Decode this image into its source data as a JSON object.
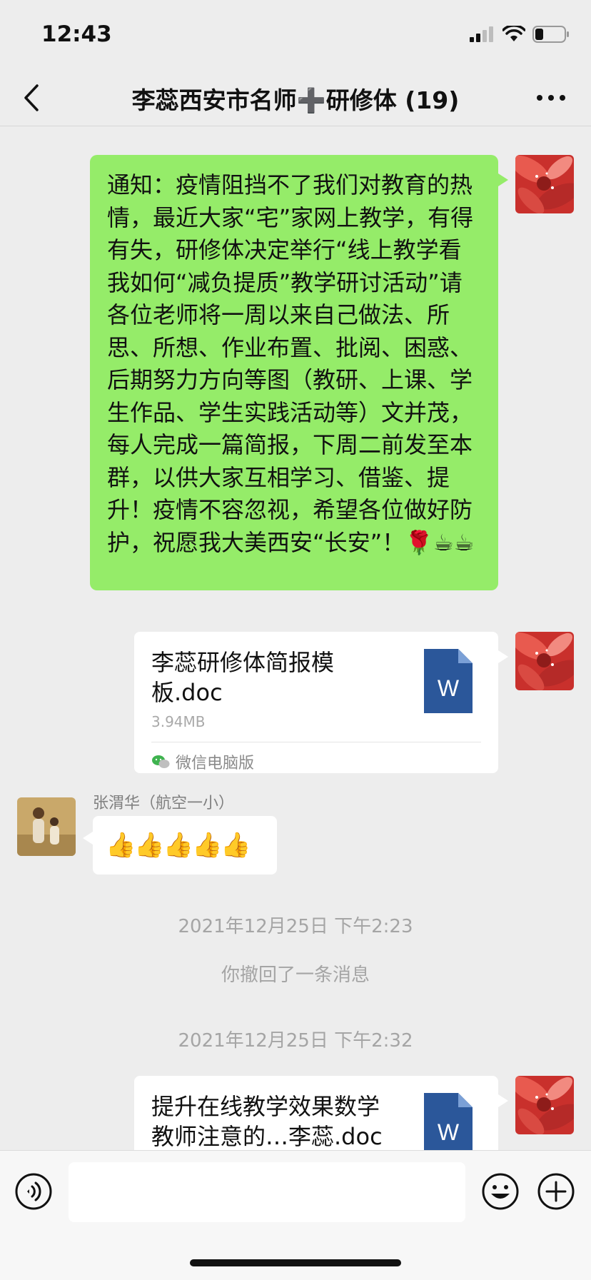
{
  "status_bar": {
    "time": "12:43"
  },
  "header": {
    "title": "李蕊西安市名师➕研修体 (19)"
  },
  "messages": {
    "notice": {
      "text": "通知：疫情阻挡不了我们对教育的热情，最近大家“宅”家网上教学，有得有失，研修体决定举行“线上教学看我如何“减负提质”教学研讨活动”请各位老师将一周以来自己做法、所思、所想、作业布置、批阅、困惑、后期努力方向等图（教研、上课、学生作品、学生实践活动等）文并茂，每人完成一篇简报，下周二前发至本群，以供大家互相学习、借鉴、提升！疫情不容忽视，希望各位做好防护，祝愿我大美西安“长安”！🌹☕☕"
    },
    "file1": {
      "name": "李蕊研修体简报模板.doc",
      "size": "3.94MB",
      "source": "微信电脑版"
    },
    "reply": {
      "sender": "张渭华（航空一小）",
      "text": "👍👍👍👍👍"
    },
    "time1": "2021年12月25日 下午2:23",
    "recall": "你撤回了一条消息",
    "time2": "2021年12月25日 下午2:32",
    "file2": {
      "name": "提升在线教学效果数学教师注意的…李蕊.doc"
    }
  },
  "file_icon_letter": "W",
  "colors": {
    "green_bubble": "#95ec69",
    "background": "#ededed",
    "word_blue": "#2b579a"
  }
}
